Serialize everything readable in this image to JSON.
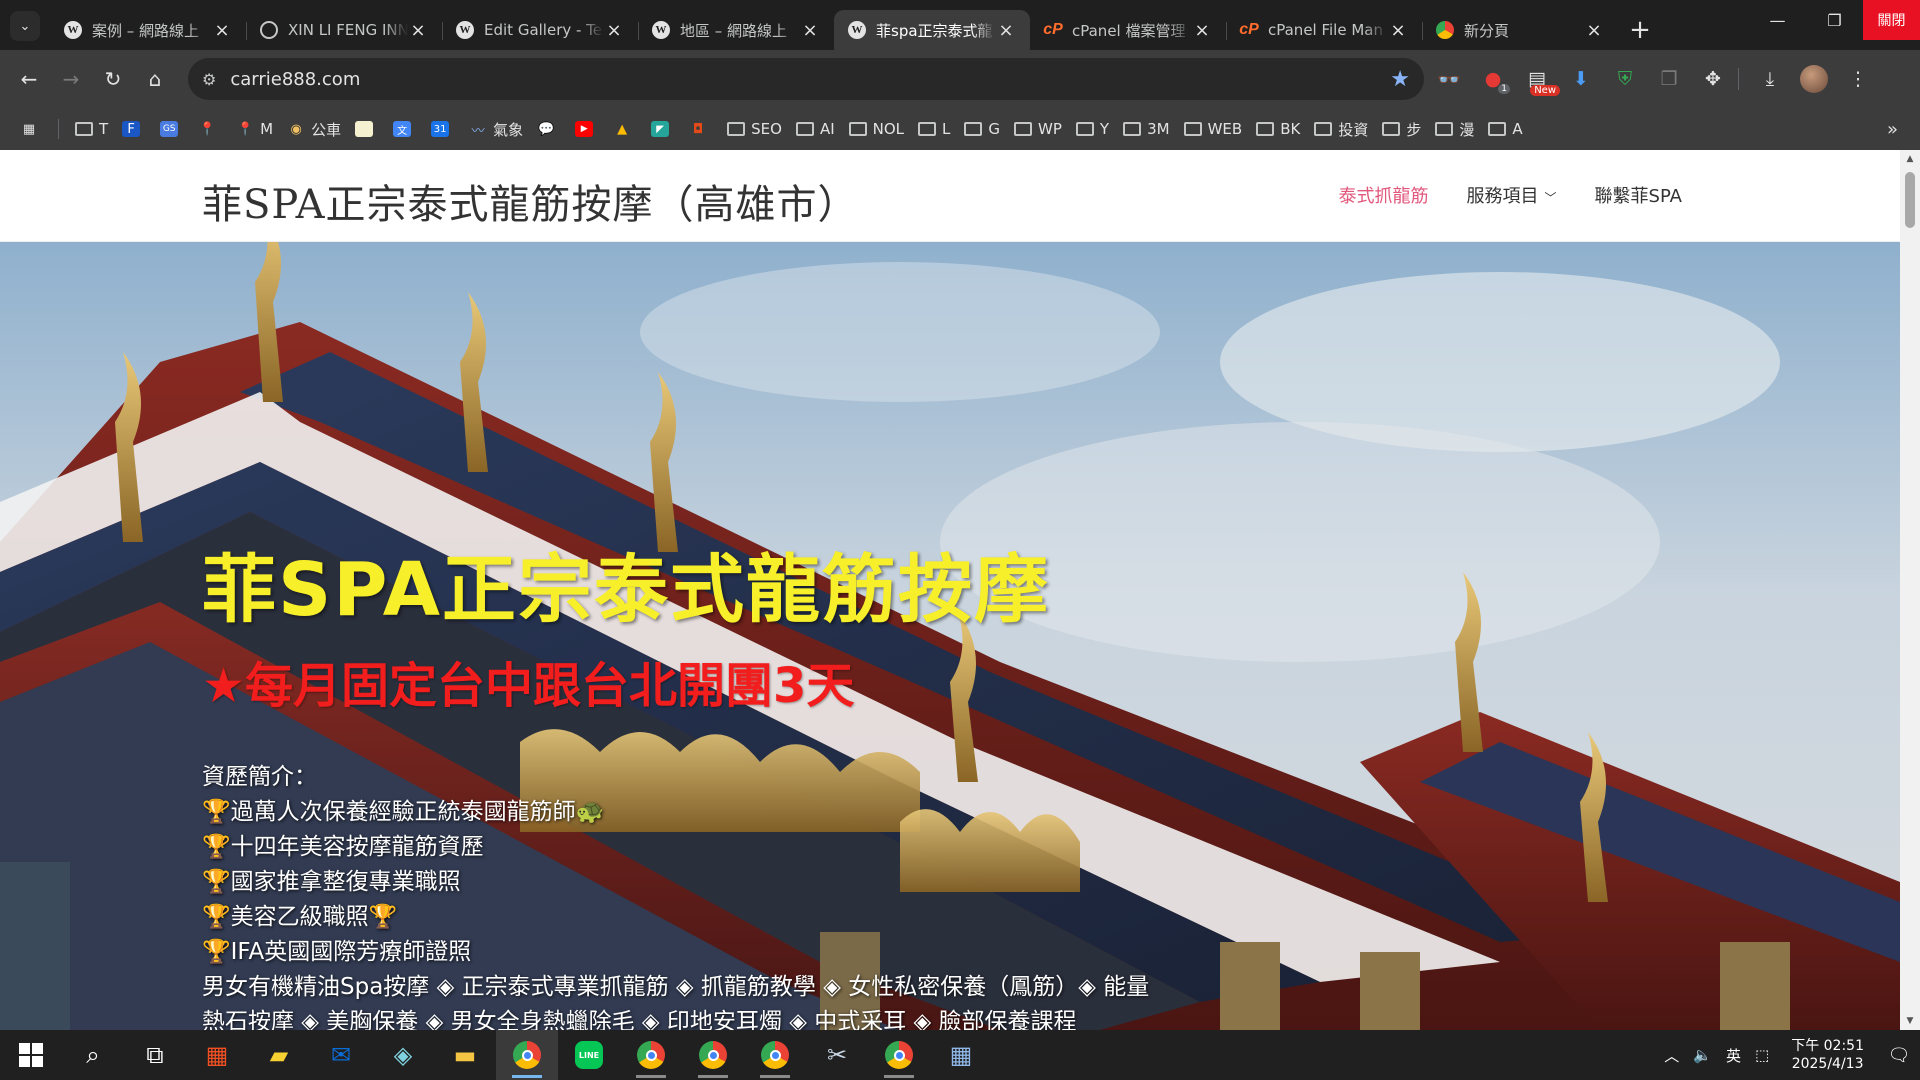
{
  "tabs": [
    {
      "title": "案例 – 網路線上",
      "icon": "wordpress-icon",
      "active": false
    },
    {
      "title": "XIN LI FENG INN",
      "icon": "globe-icon",
      "active": false
    },
    {
      "title": "Edit Gallery - Te",
      "icon": "wordpress-icon",
      "active": false
    },
    {
      "title": "地區 – 網路線上",
      "icon": "wordpress-icon",
      "active": false
    },
    {
      "title": "菲spa正宗泰式龍",
      "icon": "wordpress-icon",
      "active": true
    },
    {
      "title": "cPanel 檔案管理",
      "icon": "cpanel-icon",
      "active": false
    },
    {
      "title": "cPanel File Man",
      "icon": "cpanel-icon",
      "active": false
    },
    {
      "title": "新分頁",
      "icon": "chrome-icon",
      "active": false
    }
  ],
  "window": {
    "close_label": "關閉"
  },
  "omnibox": {
    "url": "carrie888.com"
  },
  "extensions": {
    "adblock_badge": "1",
    "new_badge": "New"
  },
  "bookmarks": [
    {
      "label": "T",
      "icon": "folder-icon"
    },
    {
      "label": "",
      "icon": "F-app-icon"
    },
    {
      "label": "",
      "icon": "gs-app-icon"
    },
    {
      "label": "",
      "icon": "maps-pin-icon"
    },
    {
      "label": "M",
      "icon": "maps-pin-icon"
    },
    {
      "label": "公車",
      "icon": "bus-app-icon"
    },
    {
      "label": "",
      "icon": "image-app-icon"
    },
    {
      "label": "",
      "icon": "translate-icon"
    },
    {
      "label": "",
      "icon": "calendar-app-icon"
    },
    {
      "label": "氣象",
      "icon": "weather-icon"
    },
    {
      "label": "",
      "icon": "chat-app-icon"
    },
    {
      "label": "",
      "icon": "youtube-icon"
    },
    {
      "label": "",
      "icon": "ads-icon"
    },
    {
      "label": "",
      "icon": "app-icon"
    },
    {
      "label": "",
      "icon": "seal-app-icon"
    },
    {
      "label": "SEO",
      "icon": "folder-icon"
    },
    {
      "label": "AI",
      "icon": "folder-icon"
    },
    {
      "label": "NOL",
      "icon": "folder-icon"
    },
    {
      "label": "L",
      "icon": "folder-icon"
    },
    {
      "label": "G",
      "icon": "folder-icon"
    },
    {
      "label": "WP",
      "icon": "folder-icon"
    },
    {
      "label": "Y",
      "icon": "folder-icon"
    },
    {
      "label": "3M",
      "icon": "folder-icon"
    },
    {
      "label": "WEB",
      "icon": "folder-icon"
    },
    {
      "label": "BK",
      "icon": "folder-icon"
    },
    {
      "label": "投資",
      "icon": "folder-icon"
    },
    {
      "label": "步",
      "icon": "folder-icon"
    },
    {
      "label": "漫",
      "icon": "folder-icon"
    },
    {
      "label": "A",
      "icon": "folder-icon"
    }
  ],
  "site": {
    "title": "菲SPA正宗泰式龍筋按摩（高雄市）",
    "nav": [
      {
        "label": "泰式抓龍筋",
        "active": true,
        "dropdown": false
      },
      {
        "label": "服務項目",
        "active": false,
        "dropdown": true
      },
      {
        "label": "聯繫菲SPA",
        "active": false,
        "dropdown": false
      }
    ]
  },
  "hero": {
    "heading": "菲SPA正宗泰式龍筋按摩",
    "subheading": "★每月固定台中跟台北開團3天",
    "intro": "資歷簡介：",
    "credentials": [
      "過萬人次保養經驗正統泰國龍筋師",
      "十四年美容按摩龍筋資歷",
      "國家推拿整復專業職照",
      "美容乙級職照",
      "IFA英國國際芳療師證照"
    ],
    "services_line1": "男女有機精油Spa按摩 ◈ 正宗泰式專業抓龍筋 ◈ 抓龍筋教學 ◈ 女性私密保養（鳳筋）◈ 能量",
    "services_line2": "熱石按摩 ◈ 美胸保養 ◈ 男女全身熱蠟除毛 ◈ 印地安耳燭 ◈ 中式采耳 ◈ 臉部保養課程"
  },
  "taskbar": {
    "tray_ime": "英",
    "time_period": "下午 02:51",
    "date": "2025/4/13"
  },
  "colors": {
    "accent": "#e2577c",
    "hero_heading": "#f7ef29",
    "hero_subheading": "#f21d1d"
  }
}
